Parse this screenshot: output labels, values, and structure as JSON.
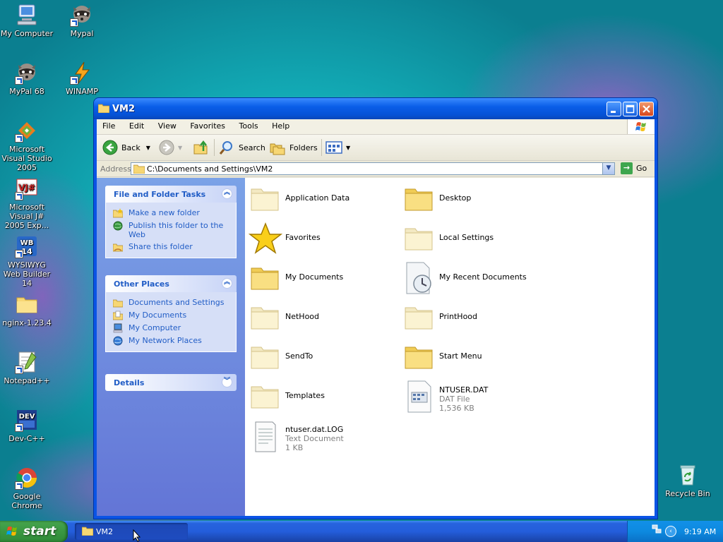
{
  "desktop": {
    "icons": [
      {
        "label": "My Computer"
      },
      {
        "label": "Mypal"
      },
      {
        "label": "MyPal 68"
      },
      {
        "label": "WINAMP"
      },
      {
        "label": "Microsoft Visual Studio 2005"
      },
      {
        "label": "Microsoft Visual J# 2005 Exp..."
      },
      {
        "label": "WYSIWYG Web Builder 14"
      },
      {
        "label": "nginx-1.23.4"
      },
      {
        "label": "Notepad++"
      },
      {
        "label": "Dev-C++"
      },
      {
        "label": "Google Chrome"
      },
      {
        "label": "Recycle Bin"
      }
    ]
  },
  "window": {
    "title": "VM2",
    "menu": [
      "File",
      "Edit",
      "View",
      "Favorites",
      "Tools",
      "Help"
    ],
    "toolbar": {
      "back": "Back",
      "search": "Search",
      "folders": "Folders"
    },
    "address": {
      "label": "Address",
      "value": "C:\\Documents and Settings\\VM2",
      "go": "Go"
    },
    "task_pane": {
      "file_tasks": {
        "title": "File and Folder Tasks",
        "items": [
          "Make a new folder",
          "Publish this folder to the Web",
          "Share this folder"
        ]
      },
      "other_places": {
        "title": "Other Places",
        "items": [
          "Documents and Settings",
          "My Documents",
          "My Computer",
          "My Network Places"
        ]
      },
      "details": {
        "title": "Details"
      }
    },
    "files": [
      {
        "name": "Application Data"
      },
      {
        "name": "Desktop"
      },
      {
        "name": "Favorites"
      },
      {
        "name": "Local Settings"
      },
      {
        "name": "My Documents"
      },
      {
        "name": "My Recent Documents"
      },
      {
        "name": "NetHood"
      },
      {
        "name": "PrintHood"
      },
      {
        "name": "SendTo"
      },
      {
        "name": "Start Menu"
      },
      {
        "name": "Templates"
      },
      {
        "name": "NTUSER.DAT",
        "type": "DAT File",
        "size": "1,536 KB"
      },
      {
        "name": "ntuser.dat.LOG",
        "type": "Text Document",
        "size": "1 KB"
      }
    ]
  },
  "taskbar": {
    "start": "start",
    "tasks": [
      {
        "label": "VM2"
      }
    ],
    "clock": "9:19 AM"
  },
  "colors": {
    "xp_blue": "#0a54e5",
    "link_blue": "#215dc6",
    "start_green": "#3c9a44"
  }
}
